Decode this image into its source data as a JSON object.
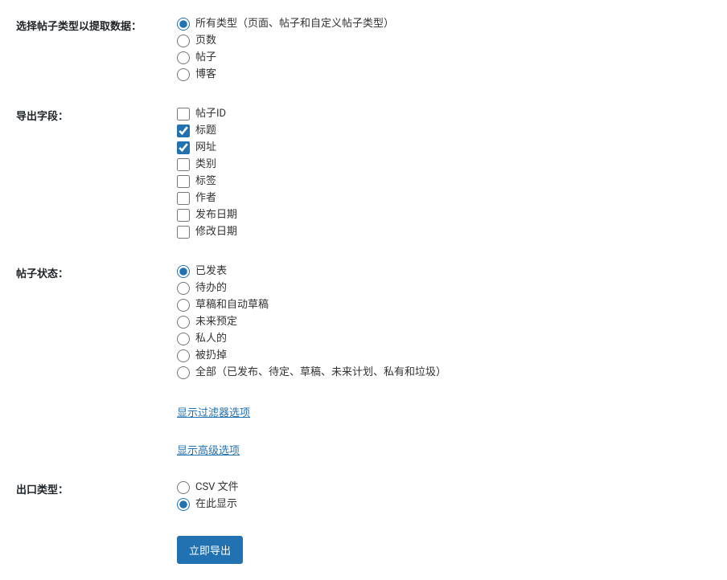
{
  "postType": {
    "label": "选择帖子类型以提取数据：",
    "options": [
      {
        "label": "所有类型（页面、帖子和自定义帖子类型）",
        "checked": true
      },
      {
        "label": "页数",
        "checked": false
      },
      {
        "label": "帖子",
        "checked": false
      },
      {
        "label": "博客",
        "checked": false
      }
    ]
  },
  "exportFields": {
    "label": "导出字段：",
    "options": [
      {
        "label": "帖子ID",
        "checked": false
      },
      {
        "label": "标题",
        "checked": true
      },
      {
        "label": "网址",
        "checked": true
      },
      {
        "label": "类别",
        "checked": false
      },
      {
        "label": "标签",
        "checked": false
      },
      {
        "label": "作者",
        "checked": false
      },
      {
        "label": "发布日期",
        "checked": false
      },
      {
        "label": "修改日期",
        "checked": false
      }
    ]
  },
  "postStatus": {
    "label": "帖子状态：",
    "options": [
      {
        "label": "已发表",
        "checked": true
      },
      {
        "label": "待办的",
        "checked": false
      },
      {
        "label": "草稿和自动草稿",
        "checked": false
      },
      {
        "label": "未来预定",
        "checked": false
      },
      {
        "label": "私人的",
        "checked": false
      },
      {
        "label": "被扔掉",
        "checked": false
      },
      {
        "label": "全部（已发布、待定、草稿、未来计划、私有和垃圾）",
        "checked": false
      }
    ]
  },
  "links": {
    "filterOptions": "显示过滤器选项",
    "advancedOptions": "显示高级选项"
  },
  "exportType": {
    "label": "出口类型：",
    "options": [
      {
        "label": "CSV 文件",
        "checked": false
      },
      {
        "label": "在此显示",
        "checked": true
      }
    ]
  },
  "buttons": {
    "export": "立即导出"
  }
}
